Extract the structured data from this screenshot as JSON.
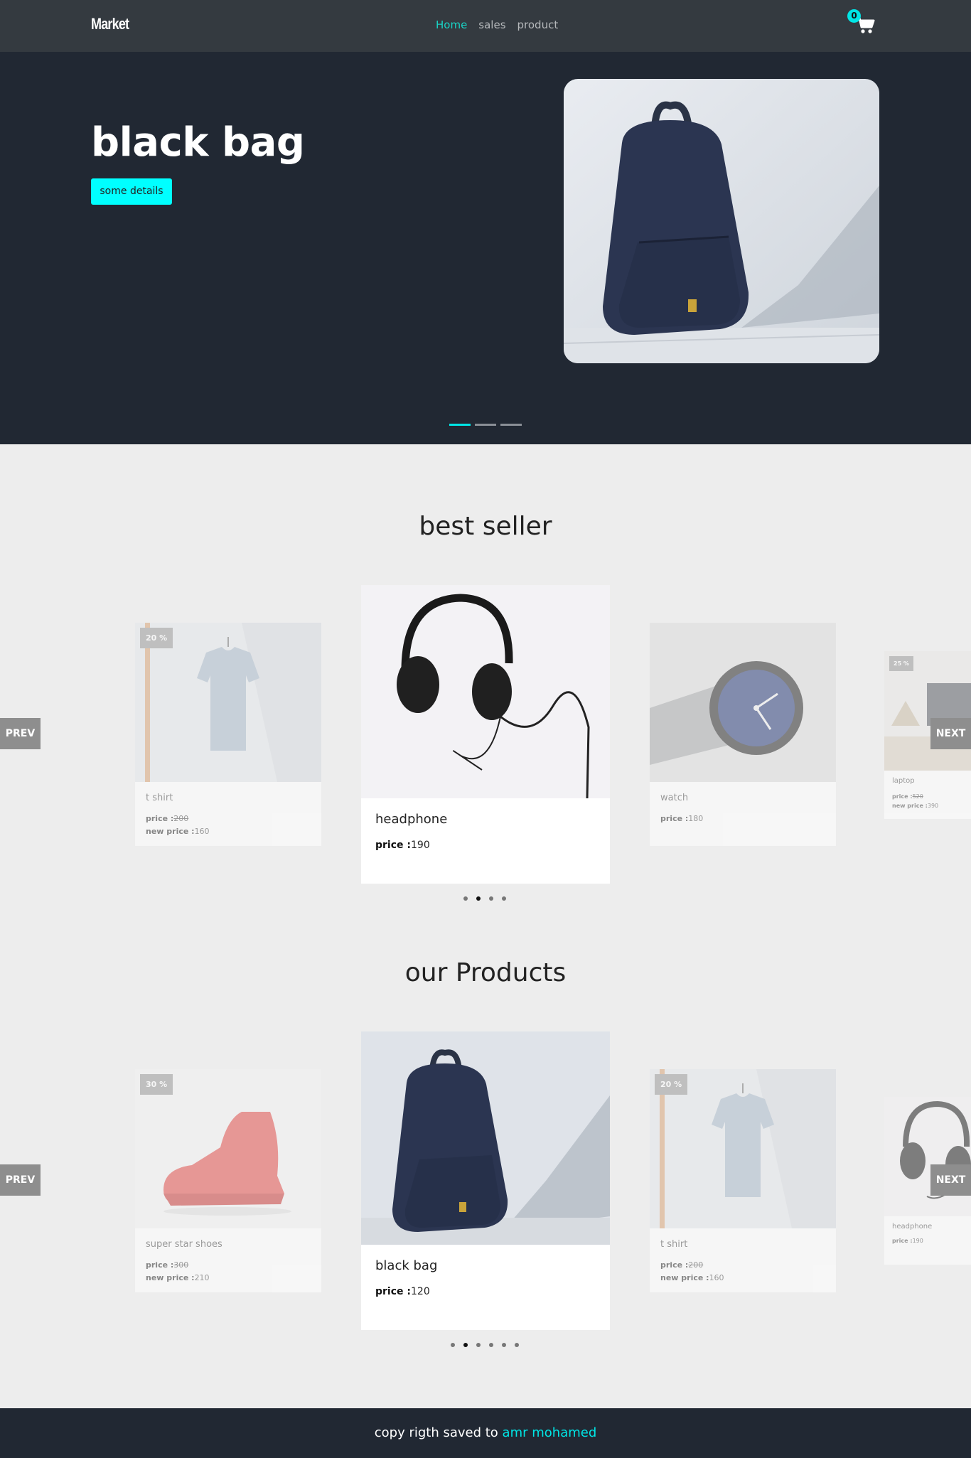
{
  "colors": {
    "accent": "#00ffff",
    "nav_bg": "#343a40",
    "hero_bg": "#212833",
    "page_bg": "#ededed",
    "active_link": "#19d3c5"
  },
  "navbar": {
    "brand": "Market",
    "links": [
      {
        "label": "Home",
        "active": true
      },
      {
        "label": "sales",
        "active": false
      },
      {
        "label": "product",
        "active": false
      }
    ],
    "cart_icon": "shopping-cart-icon",
    "cart_count": "0"
  },
  "hero": {
    "title": "black bag",
    "button_label": "some details",
    "slides": 3,
    "active_slide": 1
  },
  "best_seller": {
    "title": "best seller",
    "prev_label": "PREV",
    "next_label": "NEXT",
    "pages": 4,
    "active_page": 2,
    "cards": [
      {
        "badge": "20 %",
        "name": "t shirt",
        "price_label": "price :",
        "price": "200",
        "new_price_label": "new price :",
        "new_price": "160"
      },
      {
        "name": "headphone",
        "price_label": "price :",
        "price": "190"
      },
      {
        "name": "watch",
        "price_label": "price :",
        "price": "180"
      },
      {
        "badge": "25 %",
        "name": "laptop",
        "price_label": "price :",
        "price": "520",
        "new_price_label": "new price :",
        "new_price": "390"
      }
    ]
  },
  "our_products": {
    "title": "our Products",
    "prev_label": "PREV",
    "next_label": "NEXT",
    "pages": 6,
    "active_page": 2,
    "cards": [
      {
        "badge": "30 %",
        "name": "super star shoes",
        "price_label": "price :",
        "price": "300",
        "new_price_label": "new price :",
        "new_price": "210"
      },
      {
        "name": "black bag",
        "price_label": "price :",
        "price": "120"
      },
      {
        "badge": "20 %",
        "name": "t shirt",
        "price_label": "price :",
        "price": "200",
        "new_price_label": "new price :",
        "new_price": "160"
      },
      {
        "name": "headphone",
        "price_label": "price :",
        "price": "190"
      }
    ]
  },
  "footer": {
    "text": "copy rigth saved to",
    "author": "amr mohamed"
  }
}
